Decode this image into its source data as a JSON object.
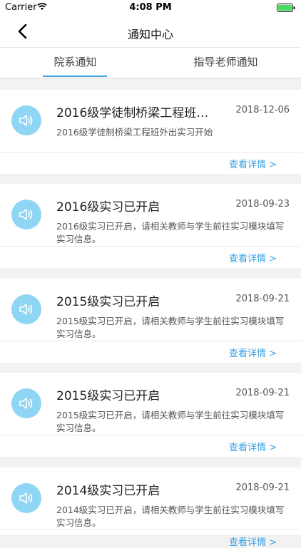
{
  "status_bar": {
    "carrier": "Carrier",
    "time": "4:08 PM"
  },
  "nav": {
    "title": "通知中心"
  },
  "tabs": [
    {
      "label": "院系通知",
      "active": true
    },
    {
      "label": "指导老师通知",
      "active": false
    }
  ],
  "notices": [
    {
      "title": "2016级学徒制桥梁工程班…",
      "date": "2018-12-06",
      "desc": "2016级学徒制桥梁工程班外出实习开始",
      "detail": "查看详情 >"
    },
    {
      "title": "2016级实习已开启",
      "date": "2018-09-23",
      "desc": "2016级实习已开启，请相关教师与学生前往实习模块填写实习信息。",
      "detail": "查看详情 >"
    },
    {
      "title": "2015级实习已开启",
      "date": "2018-09-21",
      "desc": "2015级实习已开启，请相关教师与学生前往实习模块填写实习信息。",
      "detail": "查看详情 >"
    },
    {
      "title": "2015级实习已开启",
      "date": "2018-09-21",
      "desc": "2015级实习已开启，请相关教师与学生前往实习模块填写实习信息。",
      "detail": "查看详情 >"
    },
    {
      "title": "2014级实习已开启",
      "date": "2018-09-21",
      "desc": "2014级实习已开启，请相关教师与学生前往实习模块填写实习信息。",
      "detail": "查看详情 >"
    }
  ],
  "colors": {
    "accent": "#3aa3e3",
    "icon_bg": "#8fd6f5",
    "battery": "#4cd964"
  },
  "icons": {
    "back": "chevron-left-icon",
    "notice": "speaker-icon",
    "wifi": "wifi-icon",
    "battery": "battery-icon"
  }
}
